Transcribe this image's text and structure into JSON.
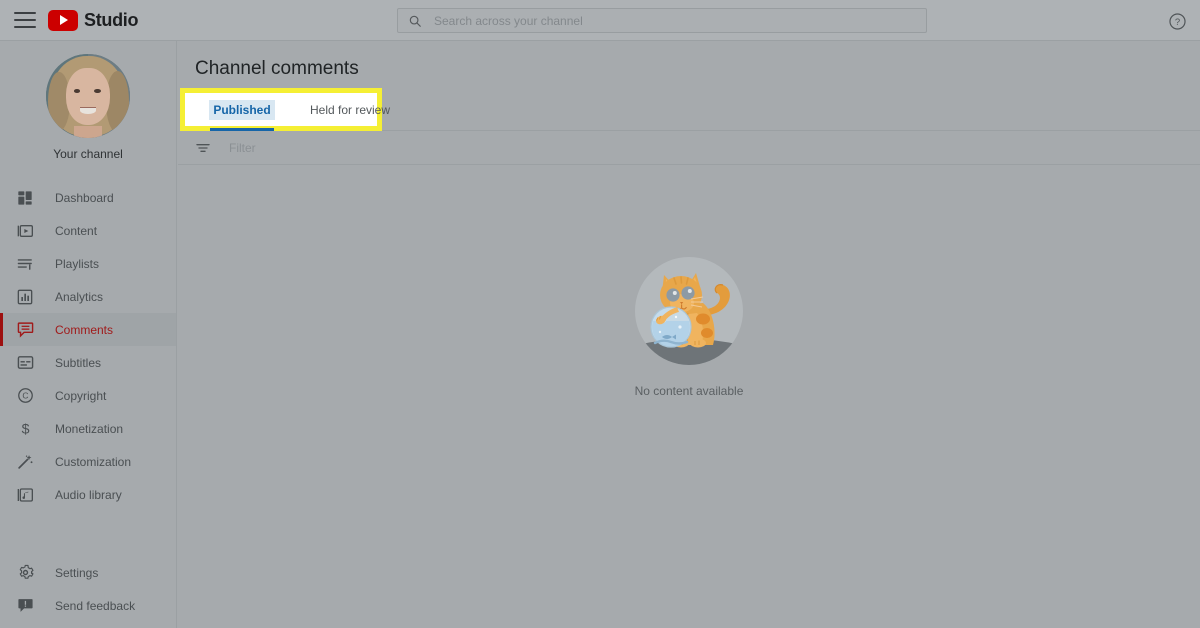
{
  "header": {
    "menu_icon": "hamburger-menu-icon",
    "logo_text": "Studio",
    "logo_icon": "youtube-play-icon",
    "logo_color": "#cc0000",
    "search": {
      "icon": "search-icon",
      "placeholder": "Search across your channel",
      "value": ""
    },
    "help_icon": "help-circle-icon"
  },
  "sidebar": {
    "channel": {
      "avatar_icon": "channel-avatar",
      "label": "Your channel"
    },
    "items": [
      {
        "label": "Dashboard",
        "icon": "dashboard-icon",
        "active": false
      },
      {
        "label": "Content",
        "icon": "content-video-icon",
        "active": false
      },
      {
        "label": "Playlists",
        "icon": "playlists-icon",
        "active": false
      },
      {
        "label": "Analytics",
        "icon": "analytics-bar-icon",
        "active": false
      },
      {
        "label": "Comments",
        "icon": "comments-icon",
        "active": true
      },
      {
        "label": "Subtitles",
        "icon": "subtitles-icon",
        "active": false
      },
      {
        "label": "Copyright",
        "icon": "copyright-icon",
        "active": false
      },
      {
        "label": "Monetization",
        "icon": "dollar-sign-icon",
        "active": false
      },
      {
        "label": "Customization",
        "icon": "magic-wand-icon",
        "active": false
      },
      {
        "label": "Audio library",
        "icon": "audio-note-icon",
        "active": false
      }
    ],
    "bottom_items": [
      {
        "label": "Settings",
        "icon": "gear-icon"
      },
      {
        "label": "Send feedback",
        "icon": "feedback-icon"
      }
    ],
    "active_color": "#9d1010"
  },
  "main": {
    "page_title": "Channel comments",
    "tabs": [
      {
        "label": "Published",
        "active": true
      },
      {
        "label": "Held for review",
        "active": false
      }
    ],
    "active_tab_color": "#1565a8",
    "filter": {
      "icon": "filter-icon",
      "placeholder": "Filter",
      "value": ""
    },
    "empty_state": {
      "illustration": "cat-with-fishbowl-illustration",
      "message": "No content available"
    }
  },
  "annotation": {
    "highlight_color": "#f5ef34",
    "target": "tabs-published-held-for-review"
  }
}
